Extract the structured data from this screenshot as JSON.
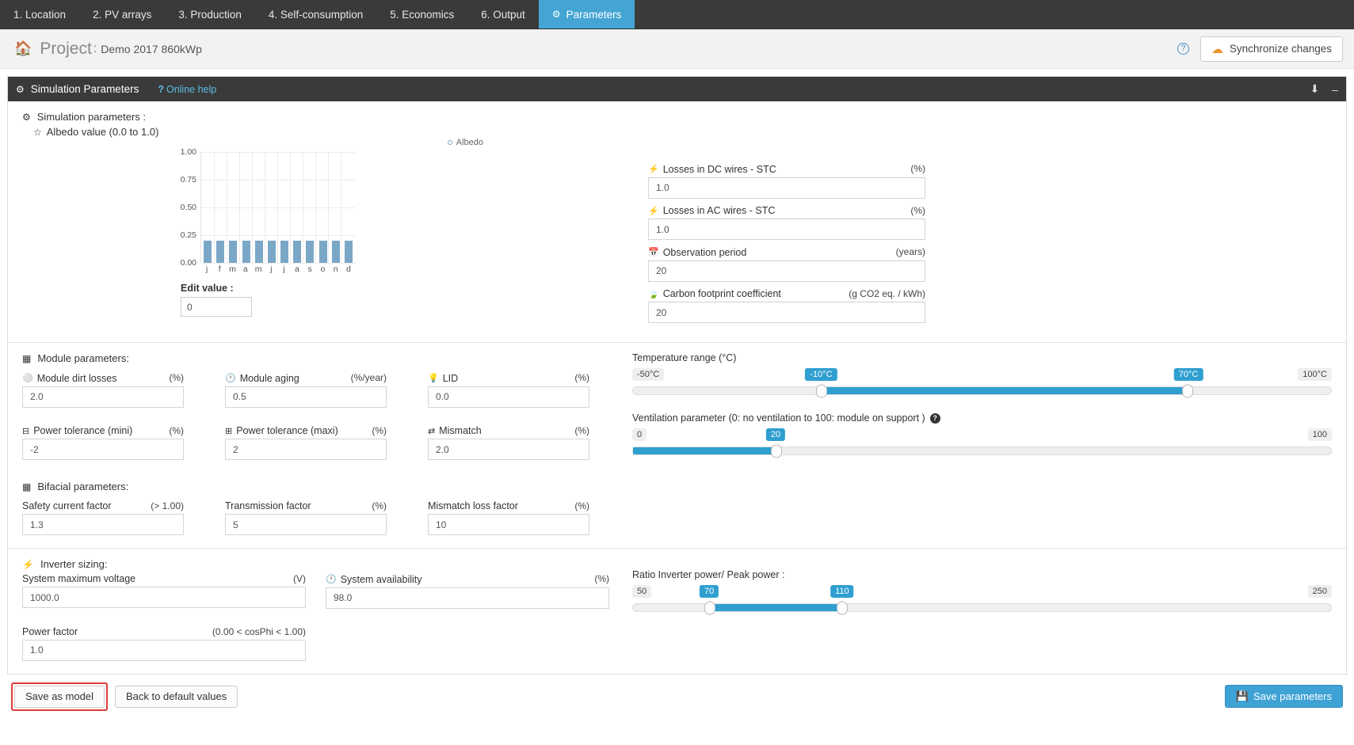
{
  "nav": {
    "tabs": [
      {
        "label": "1. Location",
        "active": false
      },
      {
        "label": "2. PV arrays",
        "active": false
      },
      {
        "label": "3. Production",
        "active": false
      },
      {
        "label": "4. Self-consumption",
        "active": false
      },
      {
        "label": "5. Economics",
        "active": false
      },
      {
        "label": "6. Output",
        "active": false
      },
      {
        "label": "Parameters",
        "active": true
      }
    ]
  },
  "header": {
    "home_icon": "home-icon",
    "project_label": "Project",
    "separator": ":",
    "project_name": "Demo 2017 860kWp",
    "help_icon": "?",
    "sync_label": "Synchronize changes",
    "sync_icon": "cloud-sync-icon"
  },
  "panel": {
    "title": "Simulation Parameters",
    "help_prefix": "?",
    "help_link": "Online help",
    "download_icon": "download-icon",
    "minimize_icon": "minimize-icon"
  },
  "simulation": {
    "section_title": "Simulation parameters :",
    "albedo_title": "Albedo value (0.0 to 1.0)",
    "edit_value_label": "Edit value :",
    "edit_value": "0",
    "fields": [
      {
        "name": "Losses in DC wires - STC",
        "unit": "(%)",
        "value": "1.0",
        "icon": "bolt-icon"
      },
      {
        "name": "Losses in AC wires - STC",
        "unit": "(%)",
        "value": "1.0",
        "icon": "bolt-icon"
      },
      {
        "name": "Observation period",
        "unit": "(years)",
        "value": "20",
        "icon": "calendar-icon"
      },
      {
        "name": "Carbon footprint coefficient",
        "unit": "(g CO2 eq. / kWh)",
        "value": "20",
        "icon": "leaf-icon"
      }
    ]
  },
  "chart_data": {
    "type": "bar",
    "title": "",
    "legend": [
      "Albedo"
    ],
    "legend_position": "top-right",
    "categories": [
      "j",
      "f",
      "m",
      "a",
      "m",
      "j",
      "j",
      "a",
      "s",
      "o",
      "n",
      "d"
    ],
    "values": [
      0.2,
      0.2,
      0.2,
      0.2,
      0.2,
      0.2,
      0.2,
      0.2,
      0.2,
      0.2,
      0.2,
      0.2
    ],
    "ylim": [
      0.0,
      1.0
    ],
    "yticks": [
      "1.00",
      "0.75",
      "0.50",
      "0.25",
      "0.00"
    ],
    "xlabel": "",
    "ylabel": "",
    "grid": true,
    "bar_color": "#7ba7c7"
  },
  "module": {
    "section_title": "Module parameters:",
    "row1": [
      {
        "name": "Module dirt losses",
        "unit": "(%)",
        "value": "2.0",
        "icon": "minus-circle-icon"
      },
      {
        "name": "Module aging",
        "unit": "(%/year)",
        "value": "0.5",
        "icon": "clock-icon"
      },
      {
        "name": "LID",
        "unit": "(%)",
        "value": "0.0",
        "icon": "bulb-icon"
      }
    ],
    "row2": [
      {
        "name": "Power tolerance (mini)",
        "unit": "(%)",
        "value": "-2",
        "icon": "minus-square-icon"
      },
      {
        "name": "Power tolerance (maxi)",
        "unit": "(%)",
        "value": "2",
        "icon": "plus-square-icon"
      },
      {
        "name": "Mismatch",
        "unit": "(%)",
        "value": "2.0",
        "icon": "shuffle-icon"
      }
    ]
  },
  "bifacial": {
    "section_title": "Bifacial parameters:",
    "row": [
      {
        "name": "Safety current factor",
        "unit": "(> 1.00)",
        "value": "1.3"
      },
      {
        "name": "Transmission factor",
        "unit": "(%)",
        "value": "5"
      },
      {
        "name": "Mismatch loss factor",
        "unit": "(%)",
        "value": "10"
      }
    ]
  },
  "temperature_slider": {
    "title": "Temperature range (°C)",
    "min_label": "-50°C",
    "max_label": "100°C",
    "low_value": "-10°C",
    "high_value": "70°C",
    "min": -50,
    "max": 100,
    "low": -10,
    "high": 70
  },
  "ventilation_slider": {
    "title": "Ventilation parameter (0: no ventilation to 100: module on support )",
    "help_icon": "?",
    "min_label": "0",
    "max_label": "100",
    "value_label": "20",
    "min": 0,
    "max": 100,
    "value": 20
  },
  "inverter": {
    "section_title": "Inverter sizing:",
    "fields": [
      {
        "name": "System maximum voltage",
        "unit": "(V)",
        "value": "1000.0",
        "icon": ""
      },
      {
        "name": "System availability",
        "unit": "(%)",
        "value": "98.0",
        "icon": "clock-icon"
      },
      {
        "name": "Power factor",
        "unit": "(0.00 < cosPhi < 1.00)",
        "value": "1.0",
        "icon": ""
      }
    ],
    "ratio_slider": {
      "title": "Ratio Inverter power/ Peak power :",
      "min_label": "50",
      "max_label": "250",
      "low_value": "70",
      "high_value": "110",
      "min": 50,
      "max": 250,
      "low": 70,
      "high": 110
    }
  },
  "footer": {
    "save_as_model": "Save as model",
    "back_to_default": "Back to default values",
    "save_parameters": "Save parameters",
    "save_icon": "floppy-icon"
  },
  "colors": {
    "accent": "#3fa2d4",
    "nav_bg": "#3a3a3a",
    "slider": "#2f9fd0",
    "bar": "#7ba7c7",
    "highlight_red": "#e03b3b",
    "sync_orange": "#f0932b"
  }
}
